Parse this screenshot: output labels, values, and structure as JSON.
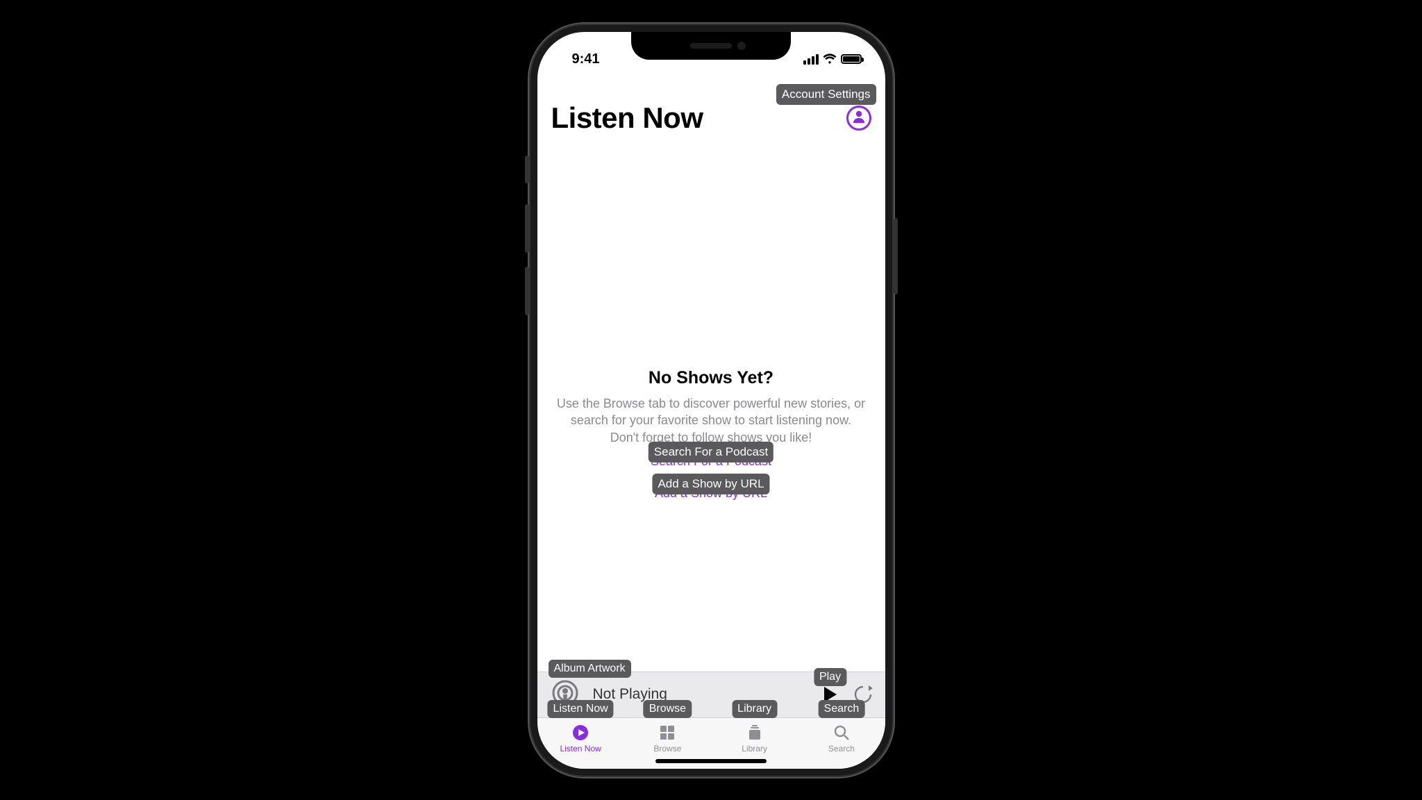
{
  "status": {
    "time": "9:41"
  },
  "header": {
    "title": "Listen Now",
    "account_tooltip": "Account Settings"
  },
  "empty": {
    "title": "No Shows Yet?",
    "body": "Use the Browse tab to discover powerful new stories, or search for your favorite show to start listening now. Don't forget to follow shows you like!",
    "search_tooltip": "Search For a Podcast",
    "search_link": "Search For a Podcast",
    "url_tooltip": "Add a Show by URL",
    "url_link": "Add a Show by URL"
  },
  "nowplaying": {
    "artwork_tooltip": "Album Artwork",
    "status": "Not Playing",
    "play_tooltip": "Play"
  },
  "tabs": {
    "listen_tooltip": "Listen Now",
    "listen_label": "Listen Now",
    "browse_tooltip": "Browse",
    "browse_label": "Browse",
    "library_tooltip": "Library",
    "library_label": "Library",
    "search_tooltip": "Search",
    "search_label": "Search"
  }
}
